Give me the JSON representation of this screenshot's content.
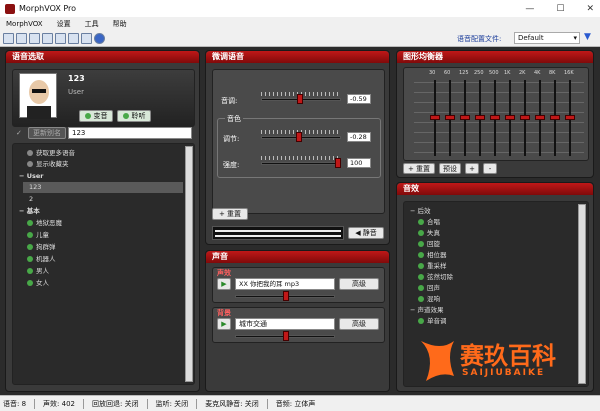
{
  "window": {
    "title": "MorphVOX Pro",
    "min": "—",
    "max": "☐",
    "close": "✕"
  },
  "menu": [
    "MorphVOX",
    "设置",
    "工具",
    "帮助"
  ],
  "toolbar": {
    "config_label": "语音配置文件:",
    "config_value": "Default"
  },
  "voice_panel": {
    "header": "语音选取",
    "name": "123",
    "user": "User",
    "listen_btn": "变音",
    "hear_btn": "聆听",
    "alias_label": "更新别名",
    "alias_value": "123",
    "list": [
      {
        "text": "获取更多语音",
        "kind": "link"
      },
      {
        "text": "显示收藏夹",
        "kind": "link"
      },
      {
        "text": "User",
        "kind": "group"
      },
      {
        "text": "123",
        "kind": "voice",
        "selected": true
      },
      {
        "text": "2",
        "kind": "voice"
      },
      {
        "text": "基本",
        "kind": "group"
      },
      {
        "text": "地狱恶魔",
        "kind": "voice"
      },
      {
        "text": "儿童",
        "kind": "voice"
      },
      {
        "text": "狗群弹",
        "kind": "voice"
      },
      {
        "text": "机器人",
        "kind": "voice"
      },
      {
        "text": "男人",
        "kind": "voice"
      },
      {
        "text": "女人",
        "kind": "voice"
      }
    ]
  },
  "tune_panel": {
    "header": "微调语音",
    "pitch_label": "音调:",
    "pitch_value": "-0.59",
    "pitch_frac": 0.48,
    "timbre_group": "音色",
    "adjust_label": "调节:",
    "adjust_value": "-0.28",
    "adjust_frac": 0.47,
    "strength_label": "强度:",
    "strength_value": "100",
    "strength_frac": 1.0,
    "reset_btn": "重置",
    "mute_btn": "静音"
  },
  "sound_panel": {
    "header": "声音",
    "effects_label": "声效",
    "effects_value": "XX 你把我的耳 mp3",
    "effects_adv": "高级",
    "bg_label": "背景",
    "bg_value": "城市交通",
    "bg_adv": "高级"
  },
  "eq_panel": {
    "header": "图形均衡器",
    "bands": [
      "30",
      "60",
      "125",
      "250",
      "500",
      "1K",
      "2K",
      "4K",
      "8K",
      "16K"
    ],
    "levels": [
      0.5,
      0.5,
      0.5,
      0.5,
      0.5,
      0.5,
      0.5,
      0.5,
      0.5,
      0.5
    ],
    "reset_btn": "重置",
    "preset_btn": "预设",
    "add_btn": "+",
    "remove_btn": "-"
  },
  "effects_panel": {
    "header": "音效",
    "items": [
      {
        "text": "后效",
        "kind": "group"
      },
      {
        "text": "合唱",
        "kind": "item"
      },
      {
        "text": "失真",
        "kind": "item"
      },
      {
        "text": "回旋",
        "kind": "item"
      },
      {
        "text": "相位器",
        "kind": "item"
      },
      {
        "text": "重采样",
        "kind": "item"
      },
      {
        "text": "弦然切除",
        "kind": "item"
      },
      {
        "text": "回声",
        "kind": "item"
      },
      {
        "text": "混响",
        "kind": "item"
      },
      {
        "text": "声道效果",
        "kind": "group"
      },
      {
        "text": "单音调",
        "kind": "item"
      }
    ]
  },
  "status": [
    "语音: 8",
    "声效: 402",
    "回放回退: 关闭",
    "监听: 关闭",
    "麦克风静音: 关闭",
    "音频: 立体声"
  ],
  "watermark": {
    "text": "赛玖百科",
    "sub": "SAIJIUBAIKE"
  }
}
